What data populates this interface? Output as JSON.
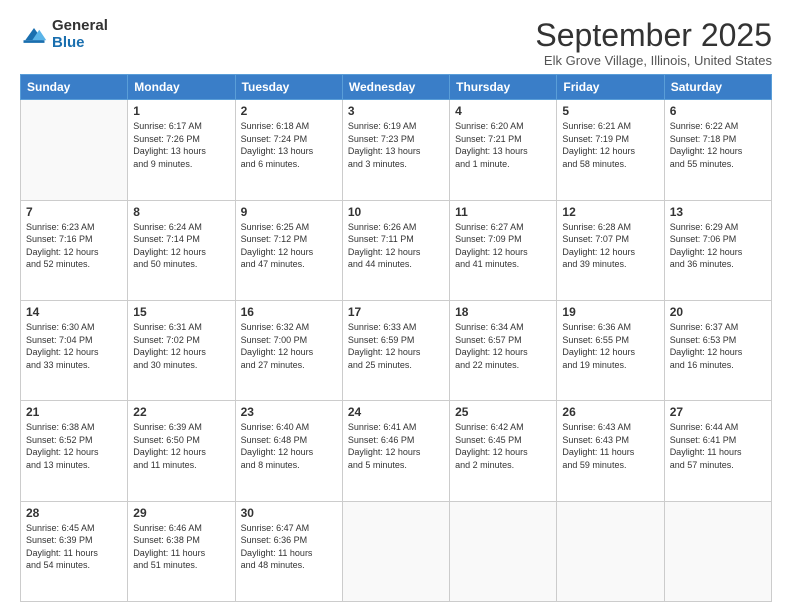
{
  "logo": {
    "general": "General",
    "blue": "Blue"
  },
  "title": "September 2025",
  "subtitle": "Elk Grove Village, Illinois, United States",
  "days": [
    "Sunday",
    "Monday",
    "Tuesday",
    "Wednesday",
    "Thursday",
    "Friday",
    "Saturday"
  ],
  "weeks": [
    [
      {
        "num": "",
        "info": ""
      },
      {
        "num": "1",
        "info": "Sunrise: 6:17 AM\nSunset: 7:26 PM\nDaylight: 13 hours\nand 9 minutes."
      },
      {
        "num": "2",
        "info": "Sunrise: 6:18 AM\nSunset: 7:24 PM\nDaylight: 13 hours\nand 6 minutes."
      },
      {
        "num": "3",
        "info": "Sunrise: 6:19 AM\nSunset: 7:23 PM\nDaylight: 13 hours\nand 3 minutes."
      },
      {
        "num": "4",
        "info": "Sunrise: 6:20 AM\nSunset: 7:21 PM\nDaylight: 13 hours\nand 1 minute."
      },
      {
        "num": "5",
        "info": "Sunrise: 6:21 AM\nSunset: 7:19 PM\nDaylight: 12 hours\nand 58 minutes."
      },
      {
        "num": "6",
        "info": "Sunrise: 6:22 AM\nSunset: 7:18 PM\nDaylight: 12 hours\nand 55 minutes."
      }
    ],
    [
      {
        "num": "7",
        "info": "Sunrise: 6:23 AM\nSunset: 7:16 PM\nDaylight: 12 hours\nand 52 minutes."
      },
      {
        "num": "8",
        "info": "Sunrise: 6:24 AM\nSunset: 7:14 PM\nDaylight: 12 hours\nand 50 minutes."
      },
      {
        "num": "9",
        "info": "Sunrise: 6:25 AM\nSunset: 7:12 PM\nDaylight: 12 hours\nand 47 minutes."
      },
      {
        "num": "10",
        "info": "Sunrise: 6:26 AM\nSunset: 7:11 PM\nDaylight: 12 hours\nand 44 minutes."
      },
      {
        "num": "11",
        "info": "Sunrise: 6:27 AM\nSunset: 7:09 PM\nDaylight: 12 hours\nand 41 minutes."
      },
      {
        "num": "12",
        "info": "Sunrise: 6:28 AM\nSunset: 7:07 PM\nDaylight: 12 hours\nand 39 minutes."
      },
      {
        "num": "13",
        "info": "Sunrise: 6:29 AM\nSunset: 7:06 PM\nDaylight: 12 hours\nand 36 minutes."
      }
    ],
    [
      {
        "num": "14",
        "info": "Sunrise: 6:30 AM\nSunset: 7:04 PM\nDaylight: 12 hours\nand 33 minutes."
      },
      {
        "num": "15",
        "info": "Sunrise: 6:31 AM\nSunset: 7:02 PM\nDaylight: 12 hours\nand 30 minutes."
      },
      {
        "num": "16",
        "info": "Sunrise: 6:32 AM\nSunset: 7:00 PM\nDaylight: 12 hours\nand 27 minutes."
      },
      {
        "num": "17",
        "info": "Sunrise: 6:33 AM\nSunset: 6:59 PM\nDaylight: 12 hours\nand 25 minutes."
      },
      {
        "num": "18",
        "info": "Sunrise: 6:34 AM\nSunset: 6:57 PM\nDaylight: 12 hours\nand 22 minutes."
      },
      {
        "num": "19",
        "info": "Sunrise: 6:36 AM\nSunset: 6:55 PM\nDaylight: 12 hours\nand 19 minutes."
      },
      {
        "num": "20",
        "info": "Sunrise: 6:37 AM\nSunset: 6:53 PM\nDaylight: 12 hours\nand 16 minutes."
      }
    ],
    [
      {
        "num": "21",
        "info": "Sunrise: 6:38 AM\nSunset: 6:52 PM\nDaylight: 12 hours\nand 13 minutes."
      },
      {
        "num": "22",
        "info": "Sunrise: 6:39 AM\nSunset: 6:50 PM\nDaylight: 12 hours\nand 11 minutes."
      },
      {
        "num": "23",
        "info": "Sunrise: 6:40 AM\nSunset: 6:48 PM\nDaylight: 12 hours\nand 8 minutes."
      },
      {
        "num": "24",
        "info": "Sunrise: 6:41 AM\nSunset: 6:46 PM\nDaylight: 12 hours\nand 5 minutes."
      },
      {
        "num": "25",
        "info": "Sunrise: 6:42 AM\nSunset: 6:45 PM\nDaylight: 12 hours\nand 2 minutes."
      },
      {
        "num": "26",
        "info": "Sunrise: 6:43 AM\nSunset: 6:43 PM\nDaylight: 11 hours\nand 59 minutes."
      },
      {
        "num": "27",
        "info": "Sunrise: 6:44 AM\nSunset: 6:41 PM\nDaylight: 11 hours\nand 57 minutes."
      }
    ],
    [
      {
        "num": "28",
        "info": "Sunrise: 6:45 AM\nSunset: 6:39 PM\nDaylight: 11 hours\nand 54 minutes."
      },
      {
        "num": "29",
        "info": "Sunrise: 6:46 AM\nSunset: 6:38 PM\nDaylight: 11 hours\nand 51 minutes."
      },
      {
        "num": "30",
        "info": "Sunrise: 6:47 AM\nSunset: 6:36 PM\nDaylight: 11 hours\nand 48 minutes."
      },
      {
        "num": "",
        "info": ""
      },
      {
        "num": "",
        "info": ""
      },
      {
        "num": "",
        "info": ""
      },
      {
        "num": "",
        "info": ""
      }
    ]
  ]
}
